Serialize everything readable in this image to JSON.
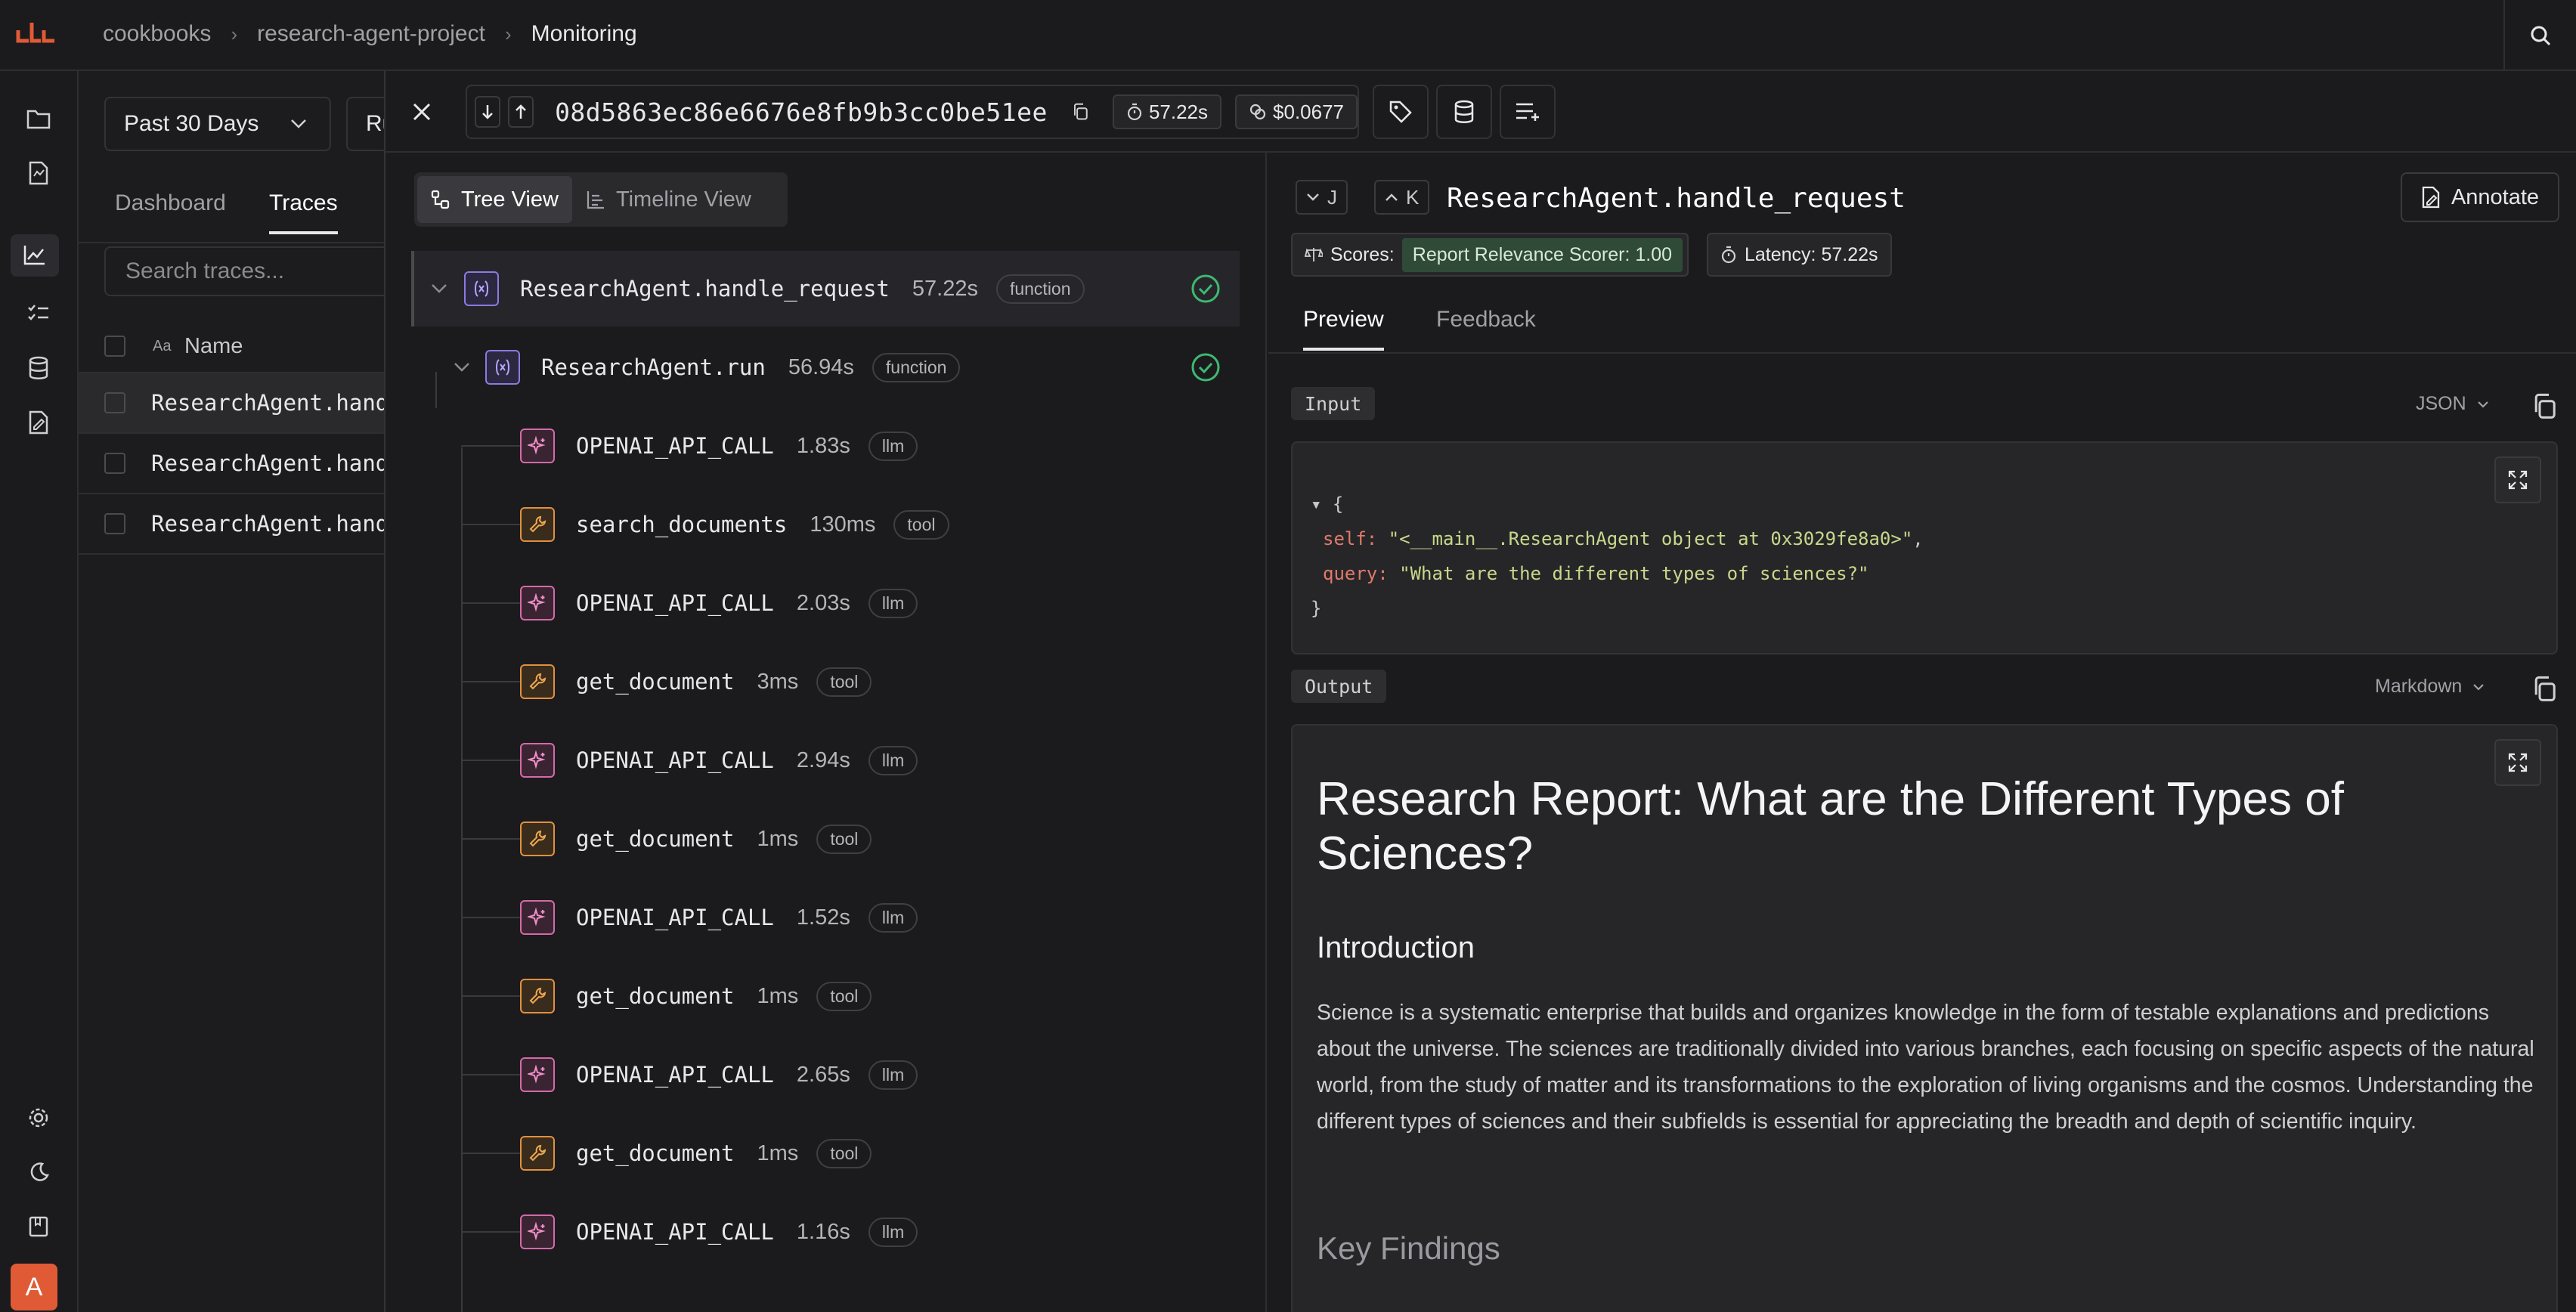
{
  "breadcrumb": {
    "items": [
      "cookbooks",
      "research-agent-project",
      "Monitoring"
    ]
  },
  "listpage": {
    "date_range": "Past 30 Days",
    "second_filter": "Ru",
    "tabs": [
      "Dashboard",
      "Traces"
    ],
    "search_placeholder": "Search traces...",
    "name_header": "Name",
    "rows": [
      "ResearchAgent.hand",
      "ResearchAgent.hand",
      "ResearchAgent.hand"
    ]
  },
  "trace": {
    "id": "08d5863ec86e6676e8fb9b3cc0be51ee",
    "duration": "57.22s",
    "cost": "$0.0677"
  },
  "tree": {
    "views": [
      "Tree View",
      "Timeline View"
    ],
    "nodes": [
      {
        "name": "ResearchAgent.handle_request",
        "dur": "57.22s",
        "tag": "function",
        "type": "fn"
      },
      {
        "name": "ResearchAgent.run",
        "dur": "56.94s",
        "tag": "function",
        "type": "fn"
      },
      {
        "name": "OPENAI_API_CALL",
        "dur": "1.83s",
        "tag": "llm",
        "type": "llm"
      },
      {
        "name": "search_documents",
        "dur": "130ms",
        "tag": "tool",
        "type": "tool"
      },
      {
        "name": "OPENAI_API_CALL",
        "dur": "2.03s",
        "tag": "llm",
        "type": "llm"
      },
      {
        "name": "get_document",
        "dur": "3ms",
        "tag": "tool",
        "type": "tool"
      },
      {
        "name": "OPENAI_API_CALL",
        "dur": "2.94s",
        "tag": "llm",
        "type": "llm"
      },
      {
        "name": "get_document",
        "dur": "1ms",
        "tag": "tool",
        "type": "tool"
      },
      {
        "name": "OPENAI_API_CALL",
        "dur": "1.52s",
        "tag": "llm",
        "type": "llm"
      },
      {
        "name": "get_document",
        "dur": "1ms",
        "tag": "tool",
        "type": "tool"
      },
      {
        "name": "OPENAI_API_CALL",
        "dur": "2.65s",
        "tag": "llm",
        "type": "llm"
      },
      {
        "name": "get_document",
        "dur": "1ms",
        "tag": "tool",
        "type": "tool"
      },
      {
        "name": "OPENAI_API_CALL",
        "dur": "1.16s",
        "tag": "llm",
        "type": "llm"
      }
    ]
  },
  "detail": {
    "nav_down_key": "J",
    "nav_up_key": "K",
    "span_name": "ResearchAgent.handle_request",
    "annotate": "Annotate",
    "scores_label": "Scores:",
    "score_chip": "Report Relevance Scorer: 1.00",
    "latency": "Latency: 57.22s",
    "tabs": [
      "Preview",
      "Feedback"
    ],
    "input_label": "Input",
    "input_format": "JSON",
    "input_code": {
      "open": "▾ {",
      "self_key": "self:",
      "self_val": "\"<__main__.ResearchAgent object at 0x3029fe8a0>\"",
      "self_comma": ",",
      "query_key": "query:",
      "query_val": "\"What are the different types of sciences?\"",
      "close": "}"
    },
    "output_label": "Output",
    "output_format": "Markdown",
    "output": {
      "h1": "Research Report: What are the Different Types of Sciences?",
      "h2": "Introduction",
      "para": "Science is a systematic enterprise that builds and organizes knowledge in the form of testable explanations and predictions about the universe. The sciences are traditionally divided into various branches, each focusing on specific aspects of the natural world, from the study of matter and its transformations to the exploration of living organisms and the cosmos. Understanding the different types of sciences and their subfields is essential for appreciating the breadth and depth of scientific inquiry.",
      "h2b": "Key Findings"
    }
  },
  "user": {
    "initial": "A"
  },
  "colors": {
    "brand": "#e05a36",
    "fn": "#8a7ce0",
    "llm": "#d46aa8",
    "tool": "#e09040",
    "success": "#3fb872"
  }
}
